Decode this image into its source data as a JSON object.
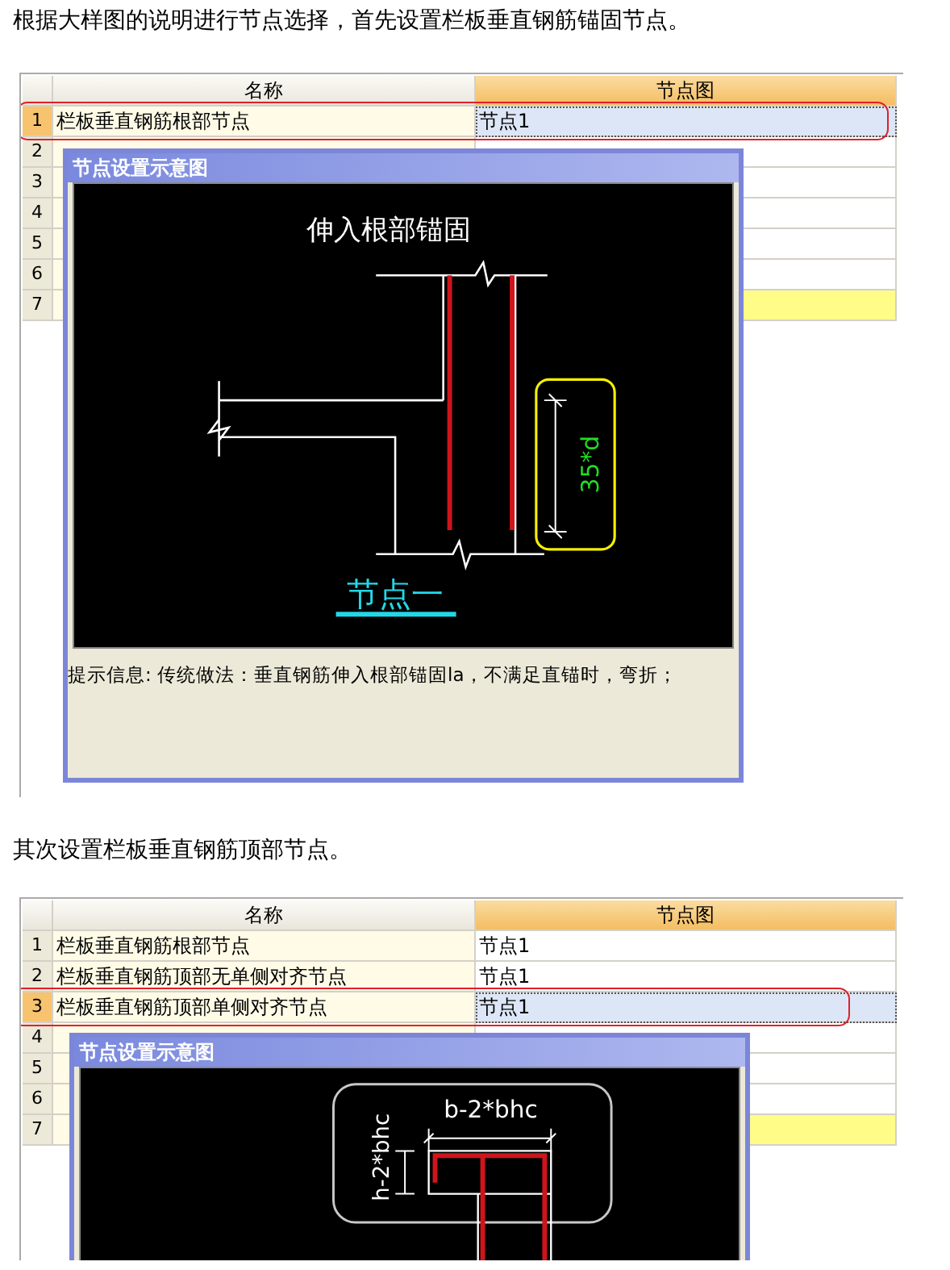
{
  "sections": [
    {
      "caption": "根据大样图的说明进行节点选择，首先设置栏板垂直钢筋锚固节点。",
      "table": {
        "columns": [
          {
            "label": "名称",
            "active": false
          },
          {
            "label": "节点图",
            "active": true
          }
        ],
        "rows": [
          {
            "number": "1",
            "name": "栏板垂直钢筋根部节点",
            "node": "节点1",
            "selected": true,
            "highlighted": false
          },
          {
            "number": "2",
            "selected": false,
            "highlighted": false
          },
          {
            "number": "3",
            "selected": false,
            "highlighted": false
          },
          {
            "number": "4",
            "selected": false,
            "highlighted": false
          },
          {
            "number": "5",
            "selected": false,
            "highlighted": false
          },
          {
            "number": "6",
            "selected": false,
            "highlighted": false
          },
          {
            "number": "7",
            "selected": false,
            "highlighted": true
          }
        ]
      },
      "dialog": {
        "title": "节点设置示意图",
        "diagram": {
          "kind": "root",
          "title": "伸入根部锚固",
          "dimension": "35*d",
          "node_label": "节点一"
        },
        "info": "提示信息: 传统做法：垂直钢筋伸入根部锚固la，不满足直锚时，弯折；"
      }
    },
    {
      "caption": "其次设置栏板垂直钢筋顶部节点。",
      "table": {
        "columns": [
          {
            "label": "名称",
            "active": false
          },
          {
            "label": "节点图",
            "active": true
          }
        ],
        "rows": [
          {
            "number": "1",
            "name": "栏板垂直钢筋根部节点",
            "node": "节点1",
            "selected": false,
            "highlighted": false
          },
          {
            "number": "2",
            "name": "栏板垂直钢筋顶部无单侧对齐节点",
            "node": "节点1",
            "selected": false,
            "highlighted": false
          },
          {
            "number": "3",
            "name": "栏板垂直钢筋顶部单侧对齐节点",
            "node": "节点1",
            "selected": true,
            "highlighted": false
          },
          {
            "number": "4",
            "selected": false,
            "highlighted": false
          },
          {
            "number": "5",
            "selected": false,
            "highlighted": false
          },
          {
            "number": "6",
            "selected": false,
            "highlighted": false
          },
          {
            "number": "7",
            "selected": false,
            "highlighted": true
          }
        ]
      },
      "dialog": {
        "title": "节点设置示意图",
        "diagram": {
          "kind": "top",
          "width_dimension": "b-2*bhc",
          "height_dimension": "h-2*bhc"
        }
      }
    }
  ]
}
